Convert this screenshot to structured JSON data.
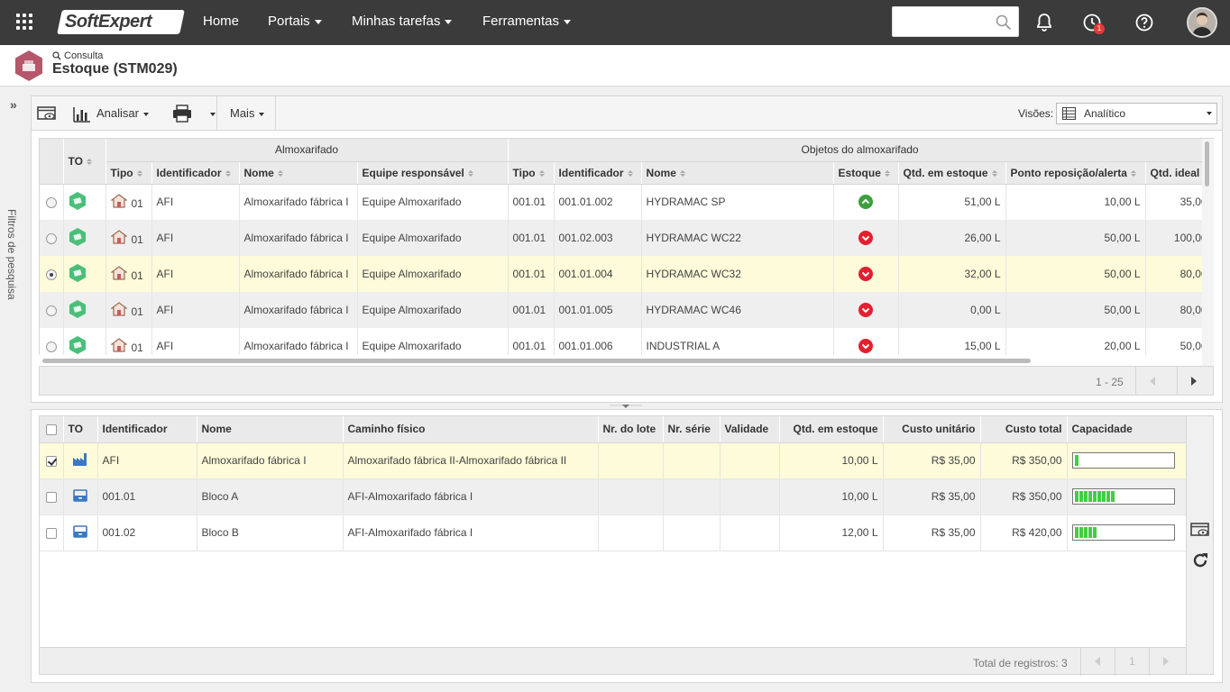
{
  "topbar": {
    "logo_text": "SoftExpert",
    "nav": [
      {
        "label": "Home",
        "has_menu": false
      },
      {
        "label": "Portais",
        "has_menu": true
      },
      {
        "label": "Minhas tarefas",
        "has_menu": true
      },
      {
        "label": "Ferramentas",
        "has_menu": true
      }
    ],
    "search_placeholder": "",
    "notification_count": "1",
    "icons": [
      "apps-grid-icon",
      "search-icon",
      "bell-icon",
      "tasks-clock-icon",
      "help-icon",
      "user-avatar"
    ]
  },
  "header": {
    "breadcrumb": "Consulta",
    "title": "Estoque (STM029)"
  },
  "sidebar": {
    "label": "Filtros de pesquisa",
    "expand_icon": "double-chevron-right-icon"
  },
  "toolbar": {
    "analisar_label": "Analisar",
    "mais_label": "Mais",
    "visoes_label": "Visões:",
    "visoes_value": "Analítico"
  },
  "grid1": {
    "group_headers": {
      "almox": "Almoxarifado",
      "objetos": "Objetos do almoxarifado"
    },
    "columns": {
      "to": "TO",
      "tipo": "Tipo",
      "identificador": "Identificador",
      "nome": "Nome",
      "equipe": "Equipe responsável",
      "tipo2": "Tipo",
      "identificador2": "Identificador",
      "nome2": "Nome",
      "estoque": "Estoque",
      "qtd": "Qtd. em estoque",
      "ponto": "Ponto reposição/alerta",
      "ideal": "Qtd. ideal"
    },
    "rows": [
      {
        "tipo": "01",
        "ident": "AFI",
        "nome": "Almoxarifado fábrica I",
        "equipe": "Equipe Almoxarifado",
        "tipo2": "001.01",
        "ident2": "001.01.002",
        "nome2": "HYDRAMAC SP",
        "estoque": "up",
        "qtd": "51,00 L",
        "ponto": "10,00 L",
        "ideal": "35,00"
      },
      {
        "tipo": "01",
        "ident": "AFI",
        "nome": "Almoxarifado fábrica I",
        "equipe": "Equipe Almoxarifado",
        "tipo2": "001.01",
        "ident2": "001.02.003",
        "nome2": "HYDRAMAC WC22",
        "estoque": "down",
        "qtd": "26,00 L",
        "ponto": "50,00 L",
        "ideal": "100,00"
      },
      {
        "tipo": "01",
        "ident": "AFI",
        "nome": "Almoxarifado fábrica I",
        "equipe": "Equipe Almoxarifado",
        "tipo2": "001.01",
        "ident2": "001.01.004",
        "nome2": "HYDRAMAC WC32",
        "estoque": "down",
        "qtd": "32,00 L",
        "ponto": "50,00 L",
        "ideal": "80,00"
      },
      {
        "tipo": "01",
        "ident": "AFI",
        "nome": "Almoxarifado fábrica I",
        "equipe": "Equipe Almoxarifado",
        "tipo2": "001.01",
        "ident2": "001.01.005",
        "nome2": "HYDRAMAC WC46",
        "estoque": "down",
        "qtd": "0,00 L",
        "ponto": "50,00 L",
        "ideal": "80,00"
      },
      {
        "tipo": "01",
        "ident": "AFI",
        "nome": "Almoxarifado fábrica I",
        "equipe": "Equipe Almoxarifado",
        "tipo2": "001.01",
        "ident2": "001.01.006",
        "nome2": "INDUSTRIAL A",
        "estoque": "down",
        "qtd": "15,00 L",
        "ponto": "20,00 L",
        "ideal": "50,00"
      }
    ],
    "selected_row": 2,
    "pager_text": "1 - 25"
  },
  "grid2": {
    "columns": {
      "to": "TO",
      "ident": "Identificador",
      "nome": "Nome",
      "caminho": "Caminho físico",
      "lote": "Nr. do lote",
      "serie": "Nr. série",
      "validade": "Validade",
      "qtd": "Qtd. em estoque",
      "custo_unit": "Custo unitário",
      "custo_total": "Custo total",
      "capacidade": "Capacidade"
    },
    "rows": [
      {
        "checked": true,
        "icon": "factory-icon",
        "ident": "AFI",
        "nome": "Almoxarifado fábrica I",
        "caminho": "Almoxarifado fábrica II-Almoxarifado fábrica II",
        "lote": "",
        "serie": "",
        "validade": "",
        "qtd": "10,00 L",
        "custo_unit": "R$ 35,00",
        "custo_total": "R$ 350,00",
        "capacidade": 0.05
      },
      {
        "checked": false,
        "icon": "storage-bin-icon",
        "ident": "001.01",
        "nome": "Bloco A",
        "caminho": "AFI-Almoxarifado fábrica I",
        "lote": "",
        "serie": "",
        "validade": "",
        "qtd": "10,00 L",
        "custo_unit": "R$ 35,00",
        "custo_total": "R$ 350,00",
        "capacidade": 0.45
      },
      {
        "checked": false,
        "icon": "storage-bin-icon",
        "ident": "001.02",
        "nome": "Bloco B",
        "caminho": "AFI-Almoxarifado fábrica I",
        "lote": "",
        "serie": "",
        "validade": "",
        "qtd": "12,00 L",
        "custo_unit": "R$ 35,00",
        "custo_total": "R$ 420,00",
        "capacidade": 0.25
      }
    ],
    "total_label": "Total de registros: 3",
    "page": "1"
  },
  "colors": {
    "topbar": "#3b3b3b",
    "selected_row": "#fdfbd9",
    "ok": "#3ca03c",
    "alert": "#e2202f",
    "capacity": "#44cc44"
  }
}
